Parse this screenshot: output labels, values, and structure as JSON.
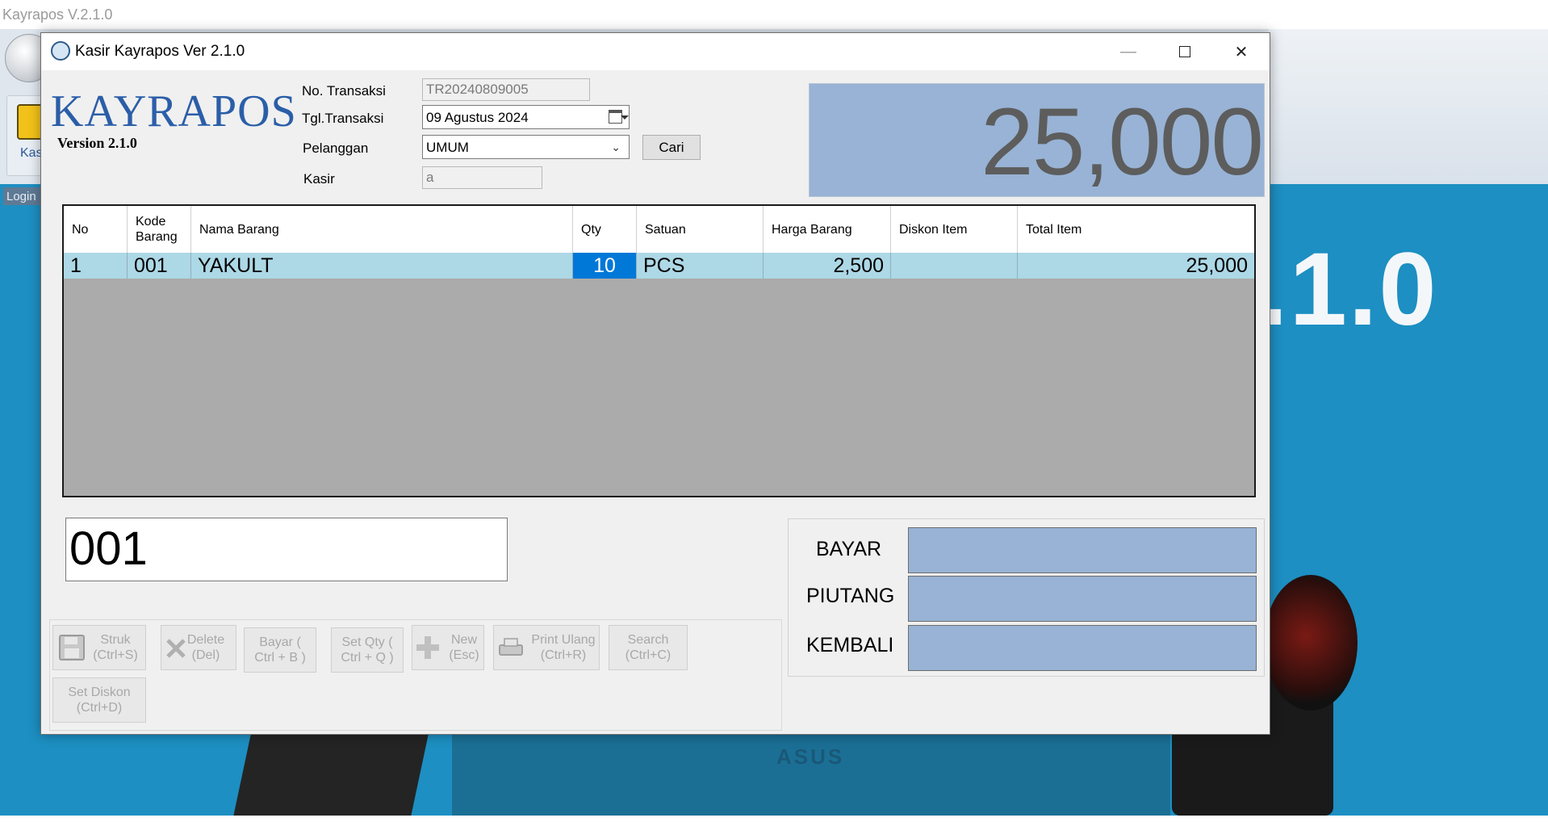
{
  "background": {
    "app_title": "Kayrapos V.2.1.0",
    "kasir_label": "Kas",
    "login_label": "Login",
    "version_splash": ".1.0",
    "laptop_brand": "ASUS"
  },
  "window": {
    "title": "Kasir Kayrapos Ver 2.1.0",
    "minimize_glyph": "—",
    "close_glyph": "✕"
  },
  "header": {
    "logo": "KAYRAPOS",
    "version": "Version 2.1.0",
    "no_transaksi_label": "No. Transaksi",
    "no_transaksi_value": "TR20240809005",
    "tgl_transaksi_label": "Tgl.Transaksi",
    "tgl_transaksi_value": "09   Agustus   2024",
    "pelanggan_label": "Pelanggan",
    "pelanggan_value": "UMUM",
    "cari_button": "Cari",
    "kasir_label": "Kasir",
    "kasir_value": "a",
    "grand_total": "25,000"
  },
  "grid": {
    "columns": [
      "No",
      "Kode Barang",
      "Nama Barang",
      "Qty",
      "Satuan",
      "Harga Barang",
      "Diskon Item",
      "Total Item"
    ],
    "rows": [
      {
        "no": "1",
        "kode": "001",
        "nama": "YAKULT",
        "qty": "10",
        "satuan": "PCS",
        "harga": "2,500",
        "diskon": "",
        "total": "25,000"
      }
    ]
  },
  "code_input_value": "001",
  "payment": {
    "bayar_label": "BAYAR",
    "piutang_label": "PIUTANG",
    "kembali_label": "KEMBALI"
  },
  "actions": {
    "struk": "Struk (Ctrl+S)",
    "delete": "Delete (Del)",
    "bayar": "Bayar  ( Ctrl + B )",
    "set_qty": "Set Qty ( Ctrl + Q )",
    "new": "New (Esc)",
    "print_ulang": "Print Ulang (Ctrl+R)",
    "search": "Search (Ctrl+C)",
    "set_diskon": "Set Diskon (Ctrl+D)"
  },
  "colors": {
    "panel_blue": "#98b3d5",
    "row_blue": "#add8e6",
    "selection": "#0078d7",
    "logo_blue": "#2b5ea8",
    "desktop_blue": "#1d8fc2"
  }
}
